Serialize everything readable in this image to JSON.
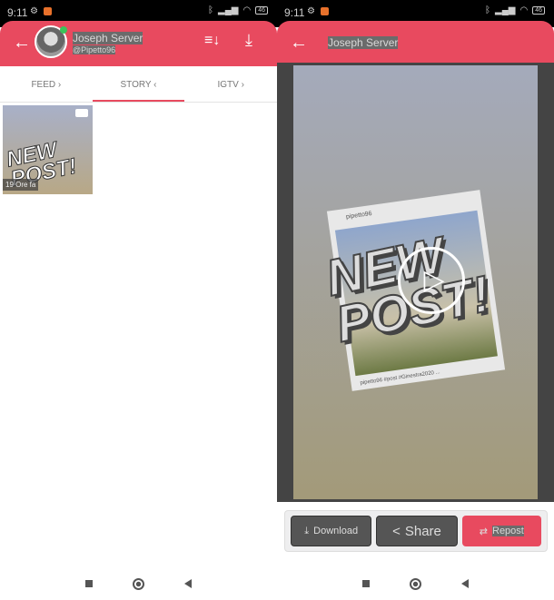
{
  "status": {
    "time": "9:11",
    "battery": "46"
  },
  "profile": {
    "name": "Joseph Server",
    "handle": "@Pipetto96",
    "online": true
  },
  "tabs": [
    {
      "label": "FEED ›"
    },
    {
      "label": "STORY ‹",
      "active": true
    },
    {
      "label": "IGTV ›"
    }
  ],
  "stories": [
    {
      "age": "19 Ore fa",
      "type": "video",
      "art_text": "NEW POST!"
    }
  ],
  "viewer": {
    "title": "Joseph Server",
    "story": {
      "art_text": "NEW POST!",
      "card_user": "pipetto96",
      "card_caption": "pipetto96 #post #Ginestra2020 ..."
    }
  },
  "actions": {
    "download": "Download",
    "share": "Share",
    "repost": "Repost"
  },
  "colors": {
    "accent": "#e84a5f",
    "button_dark": "#555555",
    "viewer_bg": "#444444"
  }
}
